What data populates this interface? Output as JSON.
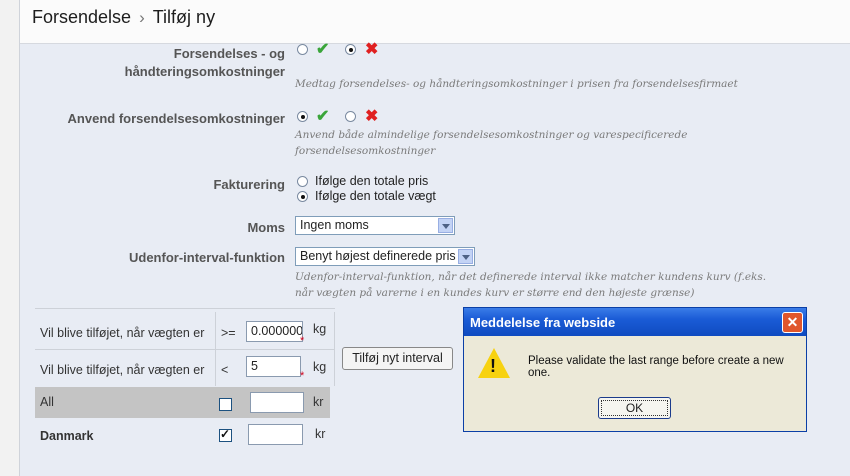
{
  "breadcrumb": {
    "section": "Forsendelse",
    "page": "Tilføj ny"
  },
  "form": {
    "shipping_handling": {
      "label_line1": "Forsendelses - og",
      "label_line2": "håndteringsomkostninger",
      "hint": "Medtag forsendelses- og håndteringsomkostninger i prisen fra forsendelsesfirmaet",
      "selected": "no"
    },
    "apply_shipping": {
      "label": "Anvend forsendelsesomkostninger",
      "hint_line1": "Anvend både almindelige forsendelsesomkostninger og varespecificerede",
      "hint_line2": "forsendelsesomkostninger",
      "selected": "yes"
    },
    "billing": {
      "label": "Fakturering",
      "options": [
        "Ifølge den totale pris",
        "Ifølge den totale vægt"
      ],
      "selected_index": 1
    },
    "tax": {
      "label": "Moms",
      "value": "Ingen moms"
    },
    "out_of_range": {
      "label": "Udenfor-interval-funktion",
      "value": "Benyt højest definerede pris",
      "hint_line1": "Udenfor-interval-funktion, når det definerede interval ikke matcher kundens kurv (f.eks.",
      "hint_line2": "når vægten på varerne i en kundes kurv er større end den højeste grænse)"
    }
  },
  "ranges": {
    "row1": {
      "label": "Vil blive tilføjet, når vægten er",
      "op": ">=",
      "value": "0.000000",
      "unit": "kg"
    },
    "row2": {
      "label": "Vil blive tilføjet, når vægten er",
      "op": "<",
      "value": "5",
      "unit": "kg"
    },
    "add_button": "Tilføj nyt interval",
    "zones": [
      {
        "name": "All",
        "checked": false,
        "value": "",
        "unit": "kr"
      },
      {
        "name": "Danmark",
        "checked": true,
        "value": "",
        "unit": "kr"
      }
    ]
  },
  "dialog": {
    "title": "Meddelelse fra webside",
    "message": "Please validate the last range before create a new one.",
    "ok_label": "OK",
    "close_glyph": "✕",
    "icon": "warning-icon"
  },
  "icons": {
    "yes": "✔",
    "no": "✖"
  },
  "colors": {
    "yes": "#3aa53a",
    "no": "#e02020",
    "title_bar": "#1a5bd6"
  }
}
